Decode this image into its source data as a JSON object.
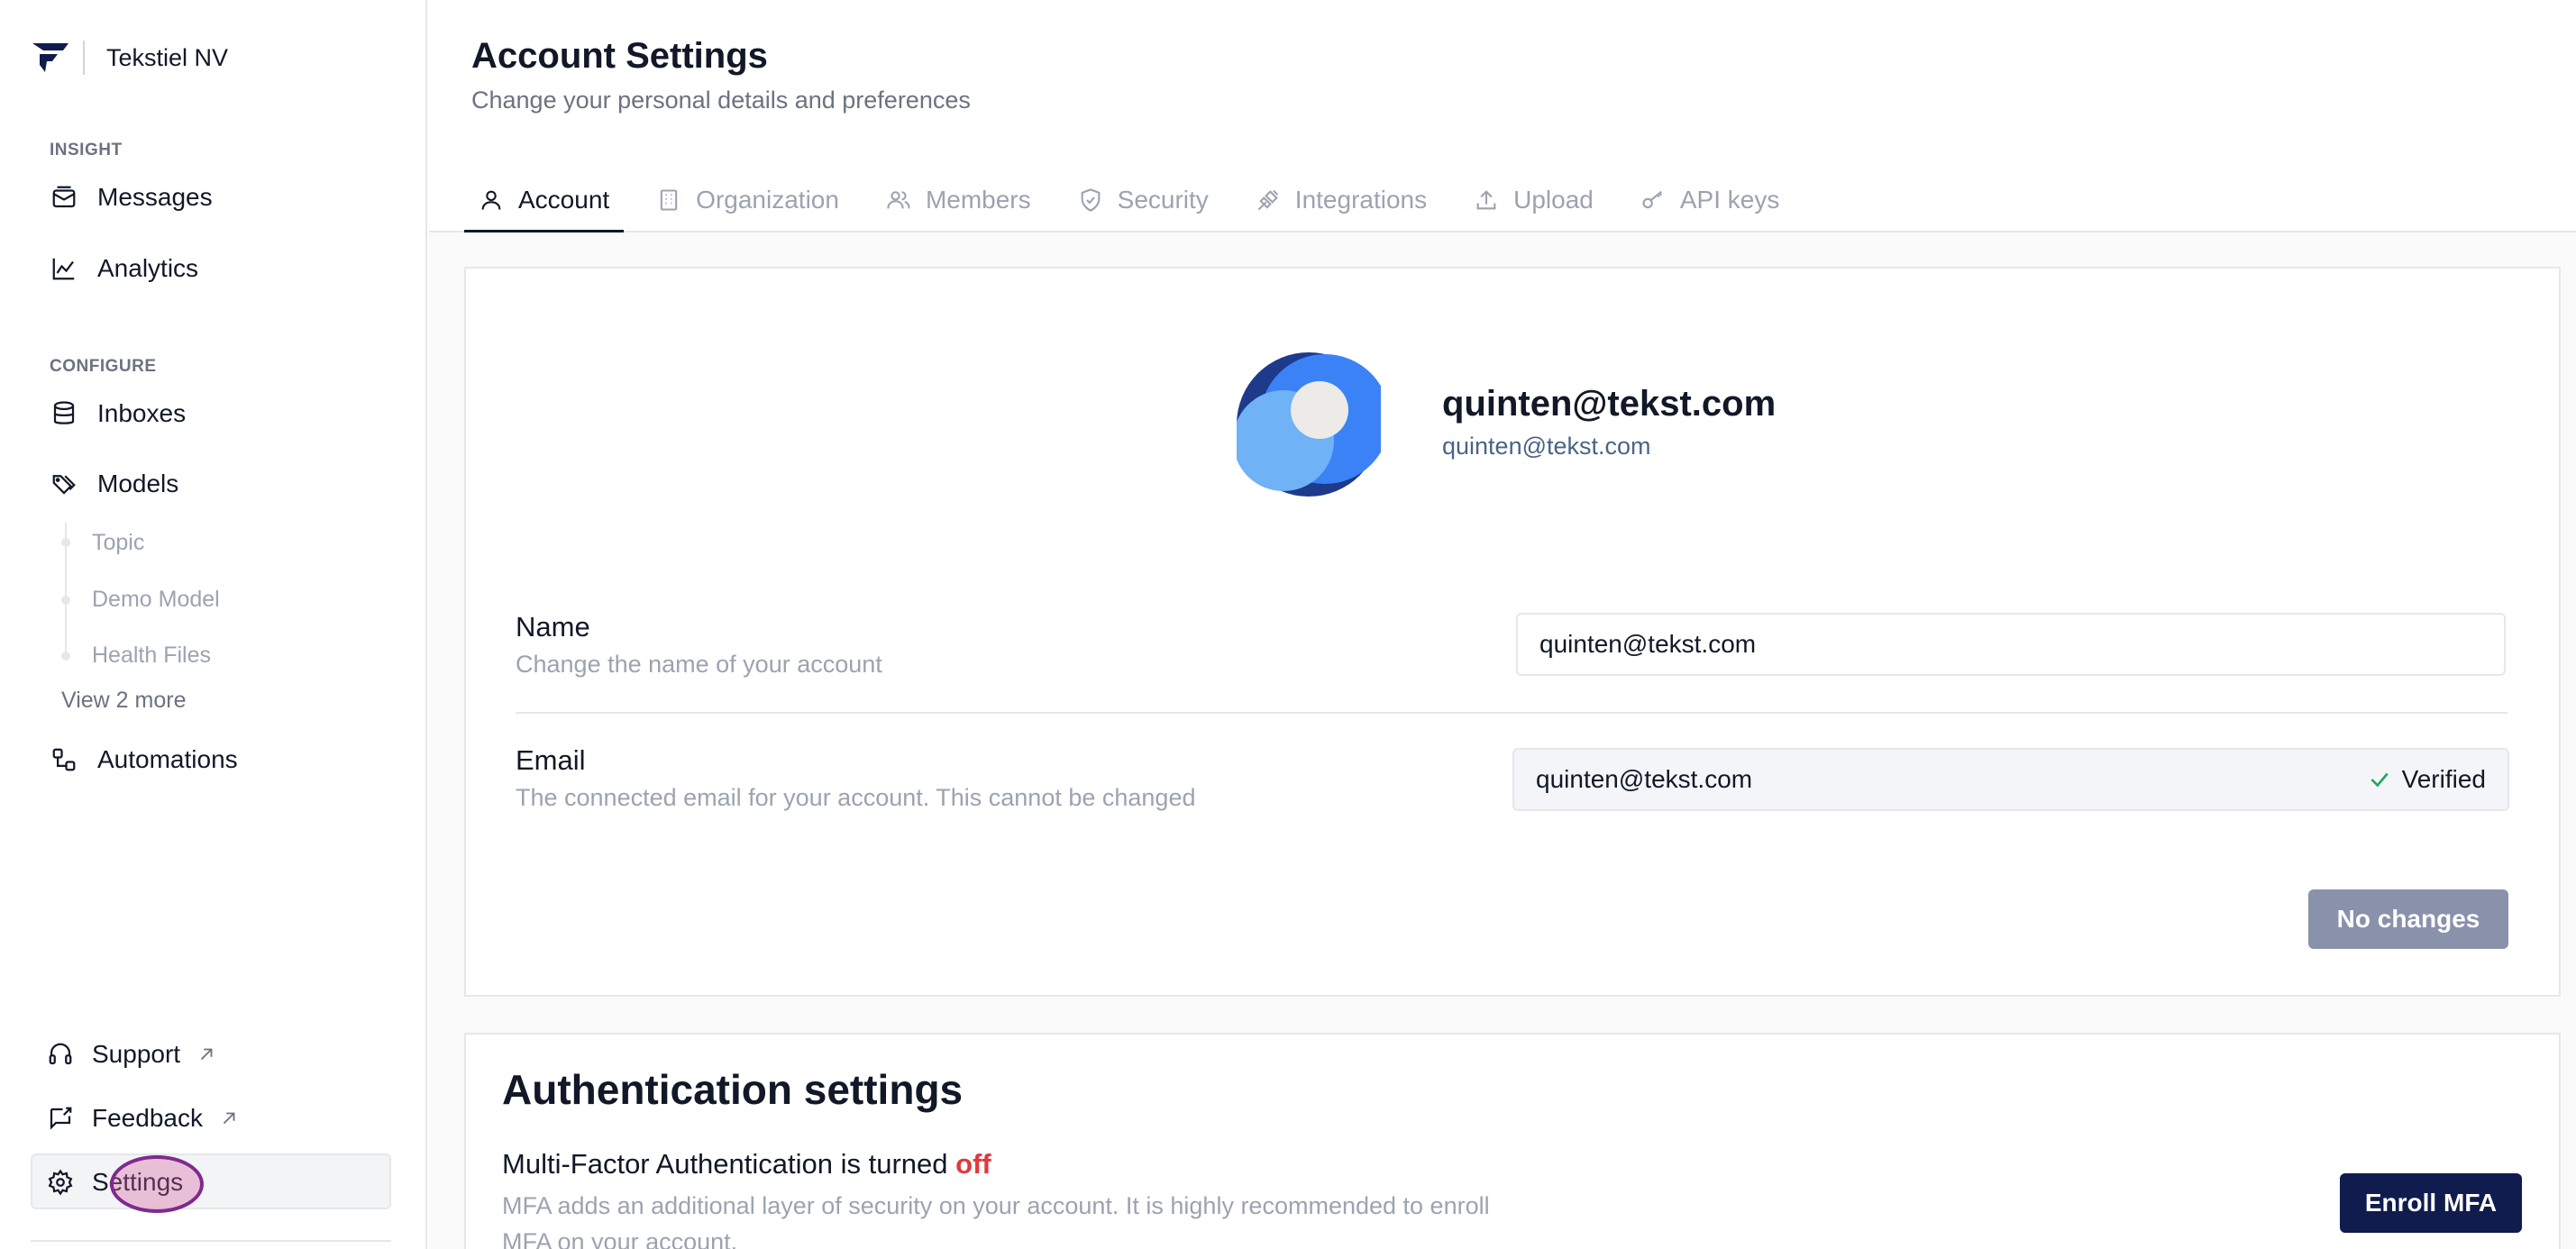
{
  "brand": {
    "name": "Tekstiel NV",
    "logo_icon": "brand-logo-icon"
  },
  "sidebar": {
    "sections": [
      {
        "label": "INSIGHT",
        "items": [
          {
            "label": "Messages",
            "icon": "messages-icon"
          },
          {
            "label": "Analytics",
            "icon": "analytics-icon"
          }
        ]
      },
      {
        "label": "CONFIGURE",
        "items": [
          {
            "label": "Inboxes",
            "icon": "database-icon"
          },
          {
            "label": "Models",
            "icon": "tags-icon"
          },
          {
            "label": "Automations",
            "icon": "automations-icon"
          }
        ]
      }
    ],
    "model_children": [
      "Topic",
      "Demo Model",
      "Health Files"
    ],
    "view_more": "View 2 more",
    "bottom": [
      {
        "label": "Support",
        "icon": "headset-icon",
        "external": true
      },
      {
        "label": "Feedback",
        "icon": "feedback-icon",
        "external": true
      },
      {
        "label": "Settings",
        "icon": "gear-icon",
        "active": true
      }
    ]
  },
  "header": {
    "title": "Account Settings",
    "subtitle": "Change your personal details and preferences"
  },
  "tabs": [
    {
      "label": "Account",
      "icon": "user-icon",
      "active": true
    },
    {
      "label": "Organization",
      "icon": "building-icon"
    },
    {
      "label": "Members",
      "icon": "users-icon"
    },
    {
      "label": "Security",
      "icon": "shield-icon"
    },
    {
      "label": "Integrations",
      "icon": "plug-icon"
    },
    {
      "label": "Upload",
      "icon": "upload-icon"
    },
    {
      "label": "API keys",
      "icon": "key-icon"
    }
  ],
  "profile": {
    "display_name": "quinten@tekst.com",
    "email": "quinten@tekst.com"
  },
  "form": {
    "name": {
      "label": "Name",
      "description": "Change the name of your account",
      "value": "quinten@tekst.com"
    },
    "email": {
      "label": "Email",
      "description": "The connected email for your account. This cannot be changed",
      "value": "quinten@tekst.com",
      "status": "Verified"
    },
    "submit_label": "No changes"
  },
  "auth": {
    "title": "Authentication settings",
    "mfa_prefix": "Multi-Factor Authentication is turned",
    "mfa_state": "off",
    "mfa_description": "MFA adds an additional layer of security on your account. It is highly recommended to enroll MFA on your account.",
    "enroll_label": "Enroll MFA"
  },
  "colors": {
    "primary_button": "#0f1c4d",
    "disabled_button": "#8a91ab",
    "mfa_off": "#e0393e",
    "verified_check": "#22a55a"
  }
}
